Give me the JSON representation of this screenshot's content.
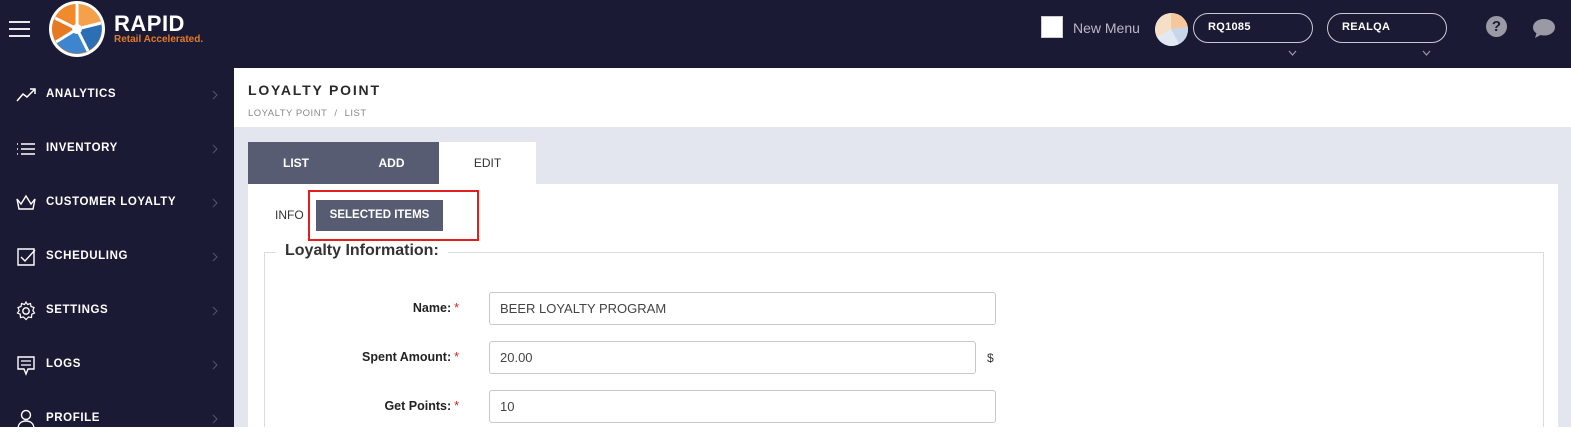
{
  "brand": {
    "name": "RAPID",
    "tagline": "Retail Accelerated.",
    "colors": {
      "navy": "#1b1a35",
      "orange": "#e67a22",
      "blue": "#2b6fb5"
    }
  },
  "topbar": {
    "new_menu_label": "New Menu",
    "store_selector": "RQ1085",
    "env_selector": "REALQA",
    "icons": [
      "hamburger-icon",
      "help-icon",
      "chat-icon"
    ]
  },
  "sidebar": {
    "items": [
      {
        "label": "ANALYTICS",
        "icon": "chart-line-icon"
      },
      {
        "label": "INVENTORY",
        "icon": "list-icon"
      },
      {
        "label": "CUSTOMER LOYALTY",
        "icon": "crown-icon"
      },
      {
        "label": "SCHEDULING",
        "icon": "calendar-check-icon"
      },
      {
        "label": "SETTINGS",
        "icon": "gear-icon"
      },
      {
        "label": "LOGS",
        "icon": "log-icon"
      },
      {
        "label": "PROFILE",
        "icon": "user-icon"
      }
    ]
  },
  "page": {
    "title": "LOYALTY POINT",
    "breadcrumb": {
      "root": "LOYALTY POINT",
      "separator": "/",
      "current": "LIST"
    }
  },
  "tabs": {
    "list": "LIST",
    "add": "ADD",
    "edit": "EDIT",
    "active": "EDIT"
  },
  "subtabs": {
    "info": "INFO",
    "selected_items": "SELECTED ITEMS",
    "active": "SELECTED ITEMS"
  },
  "form": {
    "legend": "Loyalty Information:",
    "fields": [
      {
        "label": "Name:",
        "value": "BEER LOYALTY PROGRAM",
        "required": "*"
      },
      {
        "label": "Spent Amount:",
        "value": "20.00",
        "required": "*",
        "unit": "$"
      },
      {
        "label": "Get Points:",
        "value": "10",
        "required": "*"
      }
    ]
  },
  "highlight_color": "#e21e1e"
}
